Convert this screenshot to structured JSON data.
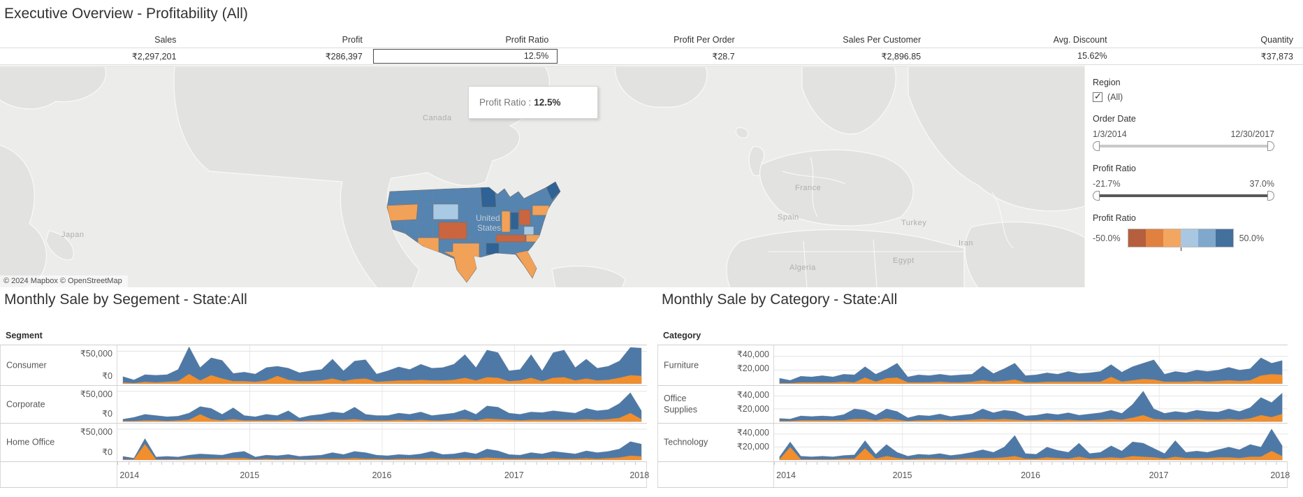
{
  "title": "Executive Overview - Profitability (All)",
  "kpis": [
    {
      "label": "Sales",
      "value": "₹2,297,201"
    },
    {
      "label": "Profit",
      "value": "₹286,397"
    },
    {
      "label": "Profit Ratio",
      "value": "12.5%",
      "selected": true
    },
    {
      "label": "Profit Per Order",
      "value": "₹28.7"
    },
    {
      "label": "Sales Per Customer",
      "value": "₹2,896.85"
    },
    {
      "label": "Avg. Discount",
      "value": "15.62%"
    },
    {
      "label": "Quantity",
      "value": "₹37,873"
    }
  ],
  "map": {
    "tooltip": {
      "label": "Profit Ratio :",
      "value": "12.5%"
    },
    "attribution": "© 2024 Mapbox  © OpenStreetMap",
    "labels": {
      "canada": "Canada",
      "japan": "Japan",
      "france": "France",
      "spain": "Spain",
      "turkey": "Turkey",
      "algeria": "Algeria",
      "egypt": "Egypt",
      "iran": "Iran",
      "us1": "United",
      "us2": "States"
    },
    "palette": {
      "base": "#5584b0",
      "dark": "#2f6295",
      "light": "#a9cae4",
      "orange": "#f1a158",
      "rust": "#ca6540"
    }
  },
  "filters": {
    "region": {
      "label": "Region",
      "option": "(All)",
      "checked": true
    },
    "order_date": {
      "label": "Order Date",
      "min": "1/3/2014",
      "max": "12/30/2017"
    },
    "profit_ratio": {
      "label": "Profit Ratio",
      "min": "-21.7%",
      "max": "37.0%"
    },
    "legend": {
      "label": "Profit Ratio",
      "min": "-50.0%",
      "max": "50.0%",
      "colors": [
        "#b55f3f",
        "#e1813f",
        "#f3a65f",
        "#a9c7e0",
        "#7fa8cc",
        "#44709d"
      ]
    }
  },
  "chart_data": [
    {
      "type": "area",
      "title": "Monthly Sale by Segement - State:All",
      "group_label": "Segment",
      "x_unit": "month",
      "x_start": "2014-01",
      "x_end": "2017-12",
      "x_points": 48,
      "x_ticks": [
        "2014",
        "2015",
        "2016",
        "2017",
        "2018"
      ],
      "y_unit": "₹ thousands",
      "y_ticks": [
        {
          "label": "₹50,000",
          "value": 50
        },
        {
          "label": "₹0",
          "value": 0
        }
      ],
      "ylim": [
        0,
        58
      ],
      "colors": {
        "sales": "#4e79a7",
        "profit": "#f28e2b"
      },
      "rows": [
        {
          "label": "Consumer",
          "series": [
            {
              "name": "Sales",
              "values": [
                11,
                6,
                14,
                13,
                14,
                22,
                57,
                25,
                40,
                36,
                16,
                18,
                15,
                25,
                27,
                24,
                17,
                20,
                22,
                38,
                20,
                35,
                37,
                15,
                20,
                26,
                22,
                30,
                24,
                25,
                30,
                45,
                25,
                52,
                48,
                20,
                22,
                45,
                20,
                48,
                52,
                25,
                38,
                24,
                27,
                35,
                56,
                55
              ]
            },
            {
              "name": "Profit",
              "values": [
                2,
                1,
                3,
                2,
                3,
                4,
                15,
                5,
                13,
                8,
                4,
                4,
                3,
                5,
                12,
                6,
                4,
                4,
                5,
                8,
                4,
                7,
                8,
                3,
                4,
                5,
                5,
                6,
                5,
                5,
                6,
                9,
                5,
                10,
                9,
                4,
                5,
                9,
                4,
                9,
                10,
                5,
                8,
                5,
                6,
                9,
                13,
                12
              ]
            }
          ]
        },
        {
          "label": "Corporate",
          "series": [
            {
              "name": "Sales",
              "values": [
                4,
                7,
                12,
                10,
                8,
                9,
                14,
                25,
                22,
                12,
                23,
                10,
                8,
                12,
                10,
                18,
                6,
                10,
                12,
                16,
                14,
                24,
                12,
                10,
                10,
                14,
                12,
                16,
                10,
                12,
                14,
                20,
                12,
                26,
                24,
                14,
                12,
                16,
                15,
                18,
                16,
                14,
                22,
                18,
                20,
                30,
                48,
                18
              ]
            },
            {
              "name": "Profit",
              "values": [
                1,
                1,
                2,
                2,
                1,
                2,
                3,
                12,
                4,
                2,
                4,
                2,
                2,
                2,
                2,
                3,
                1,
                2,
                2,
                3,
                3,
                4,
                2,
                2,
                2,
                3,
                2,
                3,
                2,
                2,
                3,
                4,
                2,
                5,
                4,
                3,
                2,
                3,
                3,
                3,
                3,
                3,
                4,
                3,
                4,
                6,
                14,
                4
              ]
            }
          ]
        },
        {
          "label": "Home Office",
          "series": [
            {
              "name": "Sales",
              "values": [
                6,
                3,
                35,
                5,
                6,
                5,
                8,
                10,
                9,
                8,
                12,
                14,
                5,
                8,
                7,
                9,
                6,
                7,
                8,
                12,
                9,
                14,
                12,
                8,
                7,
                9,
                8,
                10,
                14,
                9,
                10,
                13,
                10,
                18,
                15,
                9,
                8,
                12,
                10,
                14,
                12,
                10,
                15,
                12,
                14,
                18,
                30,
                26
              ]
            },
            {
              "name": "Profit",
              "values": [
                1,
                1,
                26,
                1,
                1,
                1,
                2,
                2,
                2,
                2,
                3,
                3,
                1,
                2,
                1,
                2,
                1,
                1,
                2,
                2,
                2,
                3,
                2,
                2,
                1,
                2,
                2,
                2,
                3,
                2,
                2,
                3,
                2,
                4,
                3,
                2,
                2,
                2,
                2,
                3,
                2,
                2,
                3,
                2,
                3,
                4,
                7,
                6
              ]
            }
          ]
        }
      ]
    },
    {
      "type": "area",
      "title": "Monthly Sale by Category - State:All",
      "group_label": "Category",
      "x_unit": "month",
      "x_start": "2014-01",
      "x_end": "2017-12",
      "x_points": 48,
      "x_ticks": [
        "2014",
        "2015",
        "2016",
        "2017",
        "2018"
      ],
      "y_unit": "₹ thousands",
      "y_ticks": [
        {
          "label": "₹40,000",
          "value": 40
        },
        {
          "label": "₹20,000",
          "value": 20
        }
      ],
      "ylim": [
        0,
        55
      ],
      "colors": {
        "sales": "#4e79a7",
        "profit": "#f28e2b"
      },
      "rows": [
        {
          "label": "Furniture",
          "series": [
            {
              "name": "Sales",
              "values": [
                8,
                5,
                11,
                10,
                12,
                10,
                14,
                13,
                25,
                14,
                21,
                30,
                10,
                13,
                12,
                14,
                12,
                13,
                14,
                26,
                15,
                22,
                30,
                12,
                13,
                16,
                14,
                18,
                15,
                16,
                18,
                28,
                17,
                25,
                30,
                35,
                14,
                18,
                16,
                20,
                18,
                20,
                24,
                20,
                22,
                38,
                30,
                34
              ]
            },
            {
              "name": "Profit",
              "values": [
                1,
                1,
                2,
                2,
                2,
                2,
                3,
                2,
                9,
                3,
                8,
                9,
                2,
                2,
                2,
                3,
                2,
                2,
                3,
                5,
                3,
                4,
                6,
                2,
                2,
                3,
                3,
                3,
                3,
                3,
                3,
                10,
                3,
                5,
                7,
                6,
                3,
                3,
                3,
                4,
                3,
                4,
                5,
                4,
                5,
                12,
                14,
                13
              ]
            }
          ]
        },
        {
          "label": "Office Supplies",
          "series": [
            {
              "name": "Sales",
              "values": [
                5,
                4,
                9,
                8,
                9,
                8,
                11,
                20,
                18,
                10,
                20,
                16,
                6,
                10,
                9,
                12,
                8,
                10,
                12,
                20,
                14,
                18,
                16,
                9,
                10,
                13,
                11,
                14,
                10,
                12,
                14,
                18,
                13,
                27,
                48,
                20,
                13,
                16,
                14,
                18,
                16,
                15,
                20,
                16,
                22,
                38,
                30,
                45
              ]
            },
            {
              "name": "Profit",
              "values": [
                1,
                1,
                2,
                2,
                2,
                2,
                2,
                4,
                4,
                2,
                5,
                3,
                1,
                2,
                2,
                3,
                2,
                2,
                3,
                4,
                3,
                4,
                3,
                2,
                2,
                3,
                2,
                3,
                2,
                2,
                3,
                4,
                3,
                6,
                10,
                4,
                3,
                3,
                3,
                4,
                3,
                3,
                4,
                3,
                5,
                10,
                7,
                12
              ]
            }
          ]
        },
        {
          "label": "Technology",
          "series": [
            {
              "name": "Sales",
              "values": [
                5,
                28,
                6,
                5,
                6,
                5,
                7,
                8,
                30,
                9,
                24,
                12,
                6,
                9,
                8,
                10,
                7,
                9,
                12,
                16,
                12,
                20,
                38,
                10,
                9,
                20,
                15,
                12,
                26,
                10,
                12,
                22,
                14,
                28,
                26,
                18,
                10,
                30,
                12,
                14,
                12,
                16,
                20,
                16,
                24,
                20,
                48,
                22
              ]
            },
            {
              "name": "Profit",
              "values": [
                1,
                20,
                1,
                1,
                1,
                1,
                2,
                2,
                18,
                2,
                6,
                3,
                1,
                2,
                2,
                2,
                1,
                2,
                3,
                3,
                3,
                4,
                6,
                2,
                2,
                4,
                3,
                2,
                5,
                2,
                3,
                4,
                3,
                6,
                5,
                4,
                2,
                5,
                3,
                3,
                3,
                4,
                4,
                3,
                5,
                5,
                14,
                6
              ]
            }
          ]
        }
      ]
    }
  ]
}
